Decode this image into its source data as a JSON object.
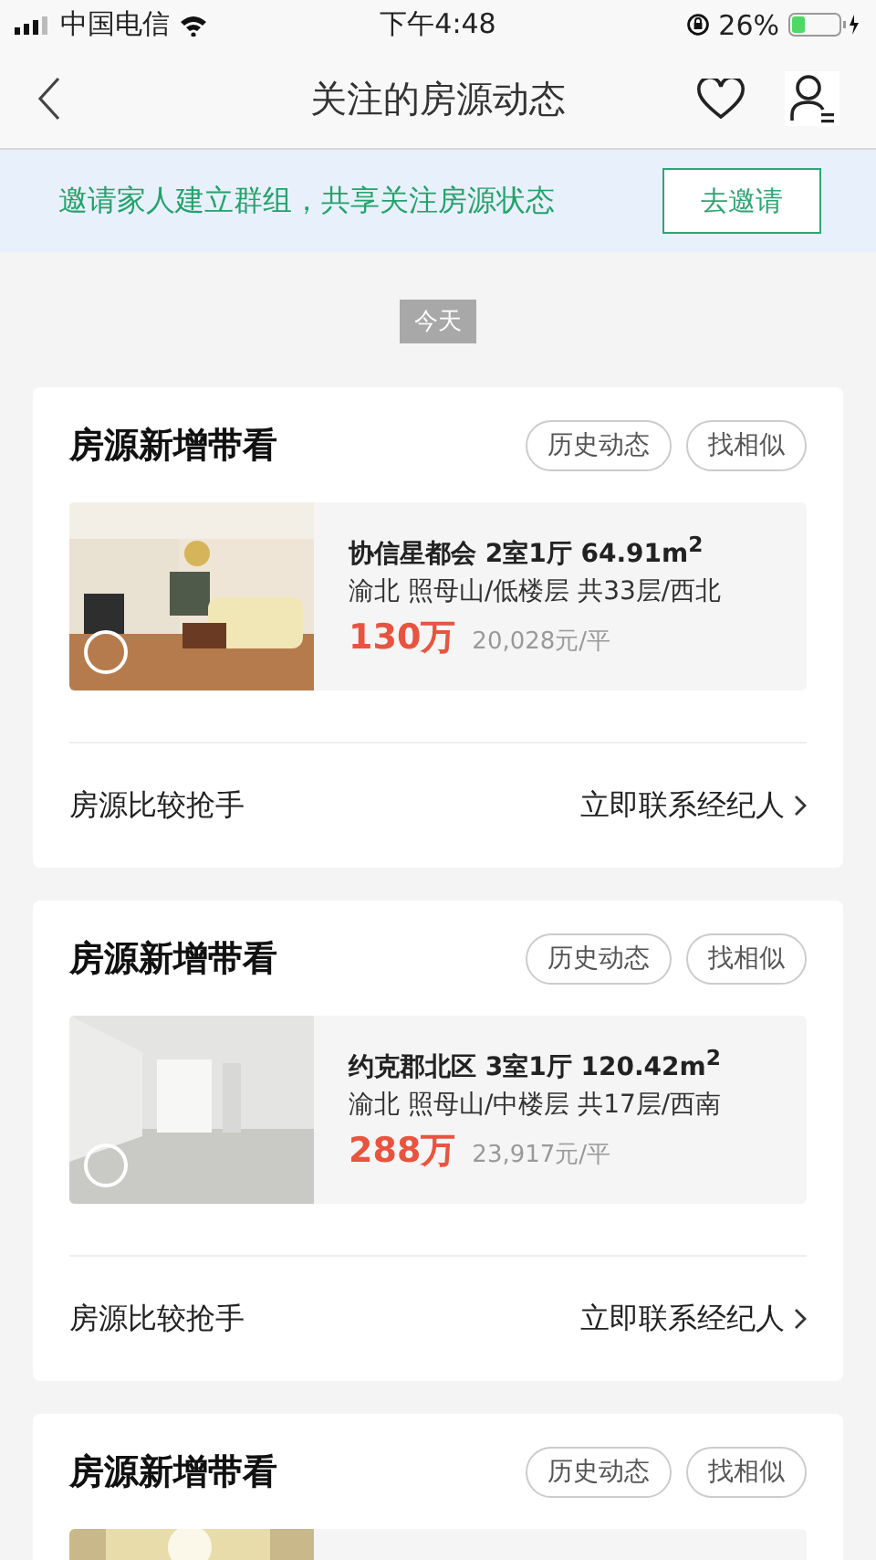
{
  "status_bar": {
    "carrier": "中国电信",
    "time": "下午4:48",
    "battery": "26%"
  },
  "nav": {
    "title": "关注的房源动态"
  },
  "invite_banner": {
    "text": "邀请家人建立群组，共享关注房源状态",
    "button": "去邀请"
  },
  "date_label": "今天",
  "cards": [
    {
      "title": "房源新增带看",
      "actions": [
        "历史动态",
        "找相似"
      ],
      "listing": {
        "kind": "picture",
        "name": "协信星都会 2室1厅 64.91m$^{2}$",
        "location": "渝北 照母山/低楼层 共33层/西北",
        "price": "130万",
        "unit_price": "20,028元/平"
      },
      "footer_left": "房源比较抢手",
      "footer_link": "立即联系经纪人"
    },
    {
      "title": "房源新增带看",
      "actions": [
        "历史动态",
        "找相似"
      ],
      "listing": {
        "kind": "picture",
        "name": "约克郡北区 3室1厅 120.42m$^{2}$",
        "location": "渝北 照母山/中楼层 共17层/西南",
        "price": "288万",
        "unit_price": "23,917元/平"
      },
      "footer_left": "房源比较抢手",
      "footer_link": "立即联系经纪人"
    },
    {
      "title": "房源新增带看",
      "actions": [
        "历史动态",
        "找相似"
      ],
      "listing": {
        "kind": "picture"
      }
    }
  ]
}
